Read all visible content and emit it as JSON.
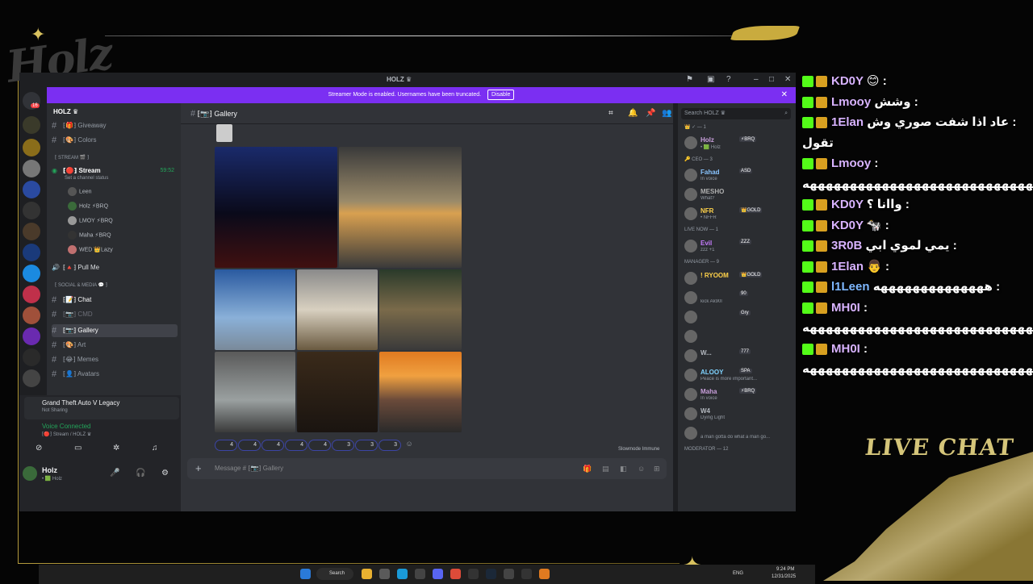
{
  "window": {
    "title": "HOLZ ♛",
    "banner_text": "Streamer Mode is enabled. Usernames have been truncated.",
    "banner_button": "Disable"
  },
  "server": {
    "name": "HOLZ ♛",
    "badge": "16",
    "channels": [
      {
        "name": "⁅🎁⁆ Giveaway"
      },
      {
        "name": "⁅🎨⁆ Colors"
      },
      {
        "name": "⁅🔴⁆ Stream",
        "timer": "59:52",
        "status": "Set a channel status"
      },
      {
        "name": "⁅🔺⁆ Pull Me"
      },
      {
        "name": "⁅📝⁆ Chat"
      },
      {
        "name": "⁅📷⁆ CMD"
      },
      {
        "name": "⁅📷⁆ Gallery"
      },
      {
        "name": "⁅🎨⁆ Art"
      },
      {
        "name": "⁅😂⁆ Memes"
      },
      {
        "name": "⁅👤⁆ Avatars"
      }
    ],
    "categories": {
      "stream": "⁅ STREAM 🎬 ⁆",
      "social": "⁅ SOCIAL & MEDIA 💬 ⁆"
    },
    "voice_members": [
      "Leen",
      "Holz ⚡BRQ",
      "LMOY ⚡BRQ",
      "Maha ⚡BRQ",
      "WED 👑Lazy"
    ]
  },
  "activity": {
    "game": "Grand Theft Auto V Legacy",
    "sub": "Not Sharing"
  },
  "voice": {
    "status": "Voice Connected",
    "channel": "⁅🔴⁆ Stream / HOLZ ♛"
  },
  "user": {
    "name": "Holz",
    "sub": "• 🟩 Holz"
  },
  "chat": {
    "channel": "⁅📷⁆ Gallery",
    "placeholder": "Message # ⁅📷⁆ Gallery",
    "slowmode": "Slowmode Immune",
    "reactions": [
      "4",
      "4",
      "4",
      "4",
      "4",
      "3",
      "3",
      "3"
    ]
  },
  "members": {
    "search_placeholder": "Search HOLZ ♛",
    "groups": [
      {
        "label": "👑 ✓ — 1",
        "items": [
          {
            "name": "Holz",
            "tag": "⚡BRQ",
            "status": "• 🟩 Holz",
            "color": "#c9a0dc"
          }
        ]
      },
      {
        "label": "🔑 CEO — 3",
        "items": [
          {
            "name": "Fahad",
            "tag": "ASD",
            "status": "In voice",
            "color": "#89c4ff"
          },
          {
            "name": "MESHO",
            "tag": "",
            "status": "What?",
            "color": "#b0b0b0"
          },
          {
            "name": "NFR",
            "tag": "👑GOLD",
            "status": "• NFFR",
            "color": "#ffd24a"
          }
        ]
      },
      {
        "label": "LIVE NOW — 1",
        "items": [
          {
            "name": "Evil",
            "tag": "ZZZ",
            "status": "zzz +1",
            "color": "#c77dff"
          }
        ]
      },
      {
        "label": "MANAGER — 9",
        "items": [
          {
            "name": "! RYOOM",
            "tag": "👑GOLD",
            "status": "",
            "color": "#ffd24a"
          },
          {
            "name": "",
            "tag": "90",
            "status": "kick Ak90l",
            "color": "#b5bac1"
          },
          {
            "name": "",
            "tag": "Gry",
            "status": "",
            "color": "#b5bac1"
          },
          {
            "name": "",
            "tag": "",
            "status": "",
            "color": "#b5bac1"
          },
          {
            "name": "W...",
            "tag": "777",
            "status": "",
            "color": "#b5bac1"
          },
          {
            "name": "ALOOY",
            "tag": "SPA",
            "status": "Peace is more important...",
            "color": "#7fd3ff"
          },
          {
            "name": "Maha",
            "tag": "⚡BRQ",
            "status": "In voice",
            "color": "#c9a0dc"
          },
          {
            "name": "W4",
            "tag": "",
            "status": "Dying Light",
            "color": "#b5bac1"
          },
          {
            "name": "",
            "tag": "",
            "status": "a man gotta do what a man go...",
            "color": "#b5bac1"
          }
        ]
      },
      {
        "label": "MODERATOR — 12",
        "items": []
      }
    ]
  },
  "taskbar": {
    "search": "Search",
    "lang": "ENG",
    "time": "9:24 PM",
    "date": "12/31/2025"
  },
  "live_chat": {
    "title": "LIVE CHAT",
    "messages": [
      {
        "user": "KD0Y",
        "text": ": 😊",
        "color": "#d8b3ff"
      },
      {
        "user": "Lmooy",
        "text": ": وشش",
        "color": "#d8b3ff"
      },
      {
        "user": "1Elan",
        "text": ": عاد اذا شفت صوري وش تقول",
        "color": "#d8b3ff"
      },
      {
        "user": "Lmooy",
        "text": ": ههههههههههههههههههههههههههههههه",
        "color": "#d8b3ff"
      },
      {
        "user": "KD0Y",
        "text": ": واانا ؟",
        "color": "#d8b3ff"
      },
      {
        "user": "KD0Y",
        "text": ": 🐄",
        "color": "#d8b3ff"
      },
      {
        "user": "3R0B",
        "text": ": يمي لموي ابي",
        "color": "#d8b3ff"
      },
      {
        "user": "1Elan",
        "text": ": 👨",
        "color": "#d8b3ff"
      },
      {
        "user": "l1Leen",
        "text": ": ههههههههههههههه",
        "color": "#7fb8ff"
      },
      {
        "user": "MH0I",
        "text": ": هههههههههههههههههههههههههههههههه",
        "color": "#d8b3ff"
      },
      {
        "user": "MH0I",
        "text": ": هههههههههههههههههههههههههههههههه",
        "color": "#d8b3ff"
      }
    ]
  }
}
